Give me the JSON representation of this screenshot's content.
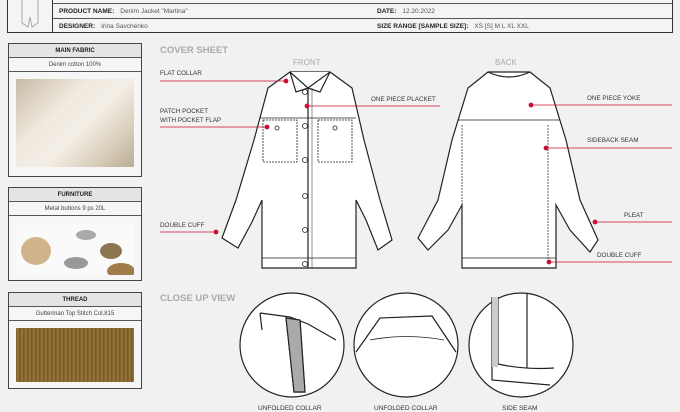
{
  "header": {
    "product_name_label": "PRODUCT NAME:",
    "product_name": "Denim Jacket \"Martina\"",
    "date_label": "DATE:",
    "date": "12.20.2022",
    "designer_label": "DESIGNER:",
    "designer": "Irina Savchenko",
    "size_range_label": "SIZE RANGE [SAMPLE SIZE]:",
    "size_range": "XS [S] M L XL XXL"
  },
  "materials": [
    {
      "title": "MAIN FABRIC",
      "desc": "Denim cotton 100%"
    },
    {
      "title": "FURNITURE",
      "desc": "Metal buttons 9 ps 20L"
    },
    {
      "title": "THREAD",
      "desc": "Gutterman Top Stitch Col.815"
    }
  ],
  "cover": {
    "title": "COVER SHEET",
    "front": "FRONT",
    "back": "BACK",
    "callouts": {
      "flat_collar": "FLAT COLLAR",
      "patch_pocket_1": "PATCH POCKET",
      "patch_pocket_2": "WITH POCKET FLAP",
      "double_cuff_front": "DOUBLE CUFF",
      "placket": "ONE PIECE PLACKET",
      "yoke": "ONE PIECE YOKE",
      "sideback": "SIDEBACK SEAM",
      "pleat": "PLEAT",
      "double_cuff_back": "DOUBLE CUFF"
    }
  },
  "closeup": {
    "title": "CLOSE UP VIEW",
    "items": [
      "UNFOLDED COLLAR",
      "UNFOLDED COLLAR",
      "SIDE SEAM"
    ]
  },
  "colors": {
    "accent": "#c8102e"
  }
}
